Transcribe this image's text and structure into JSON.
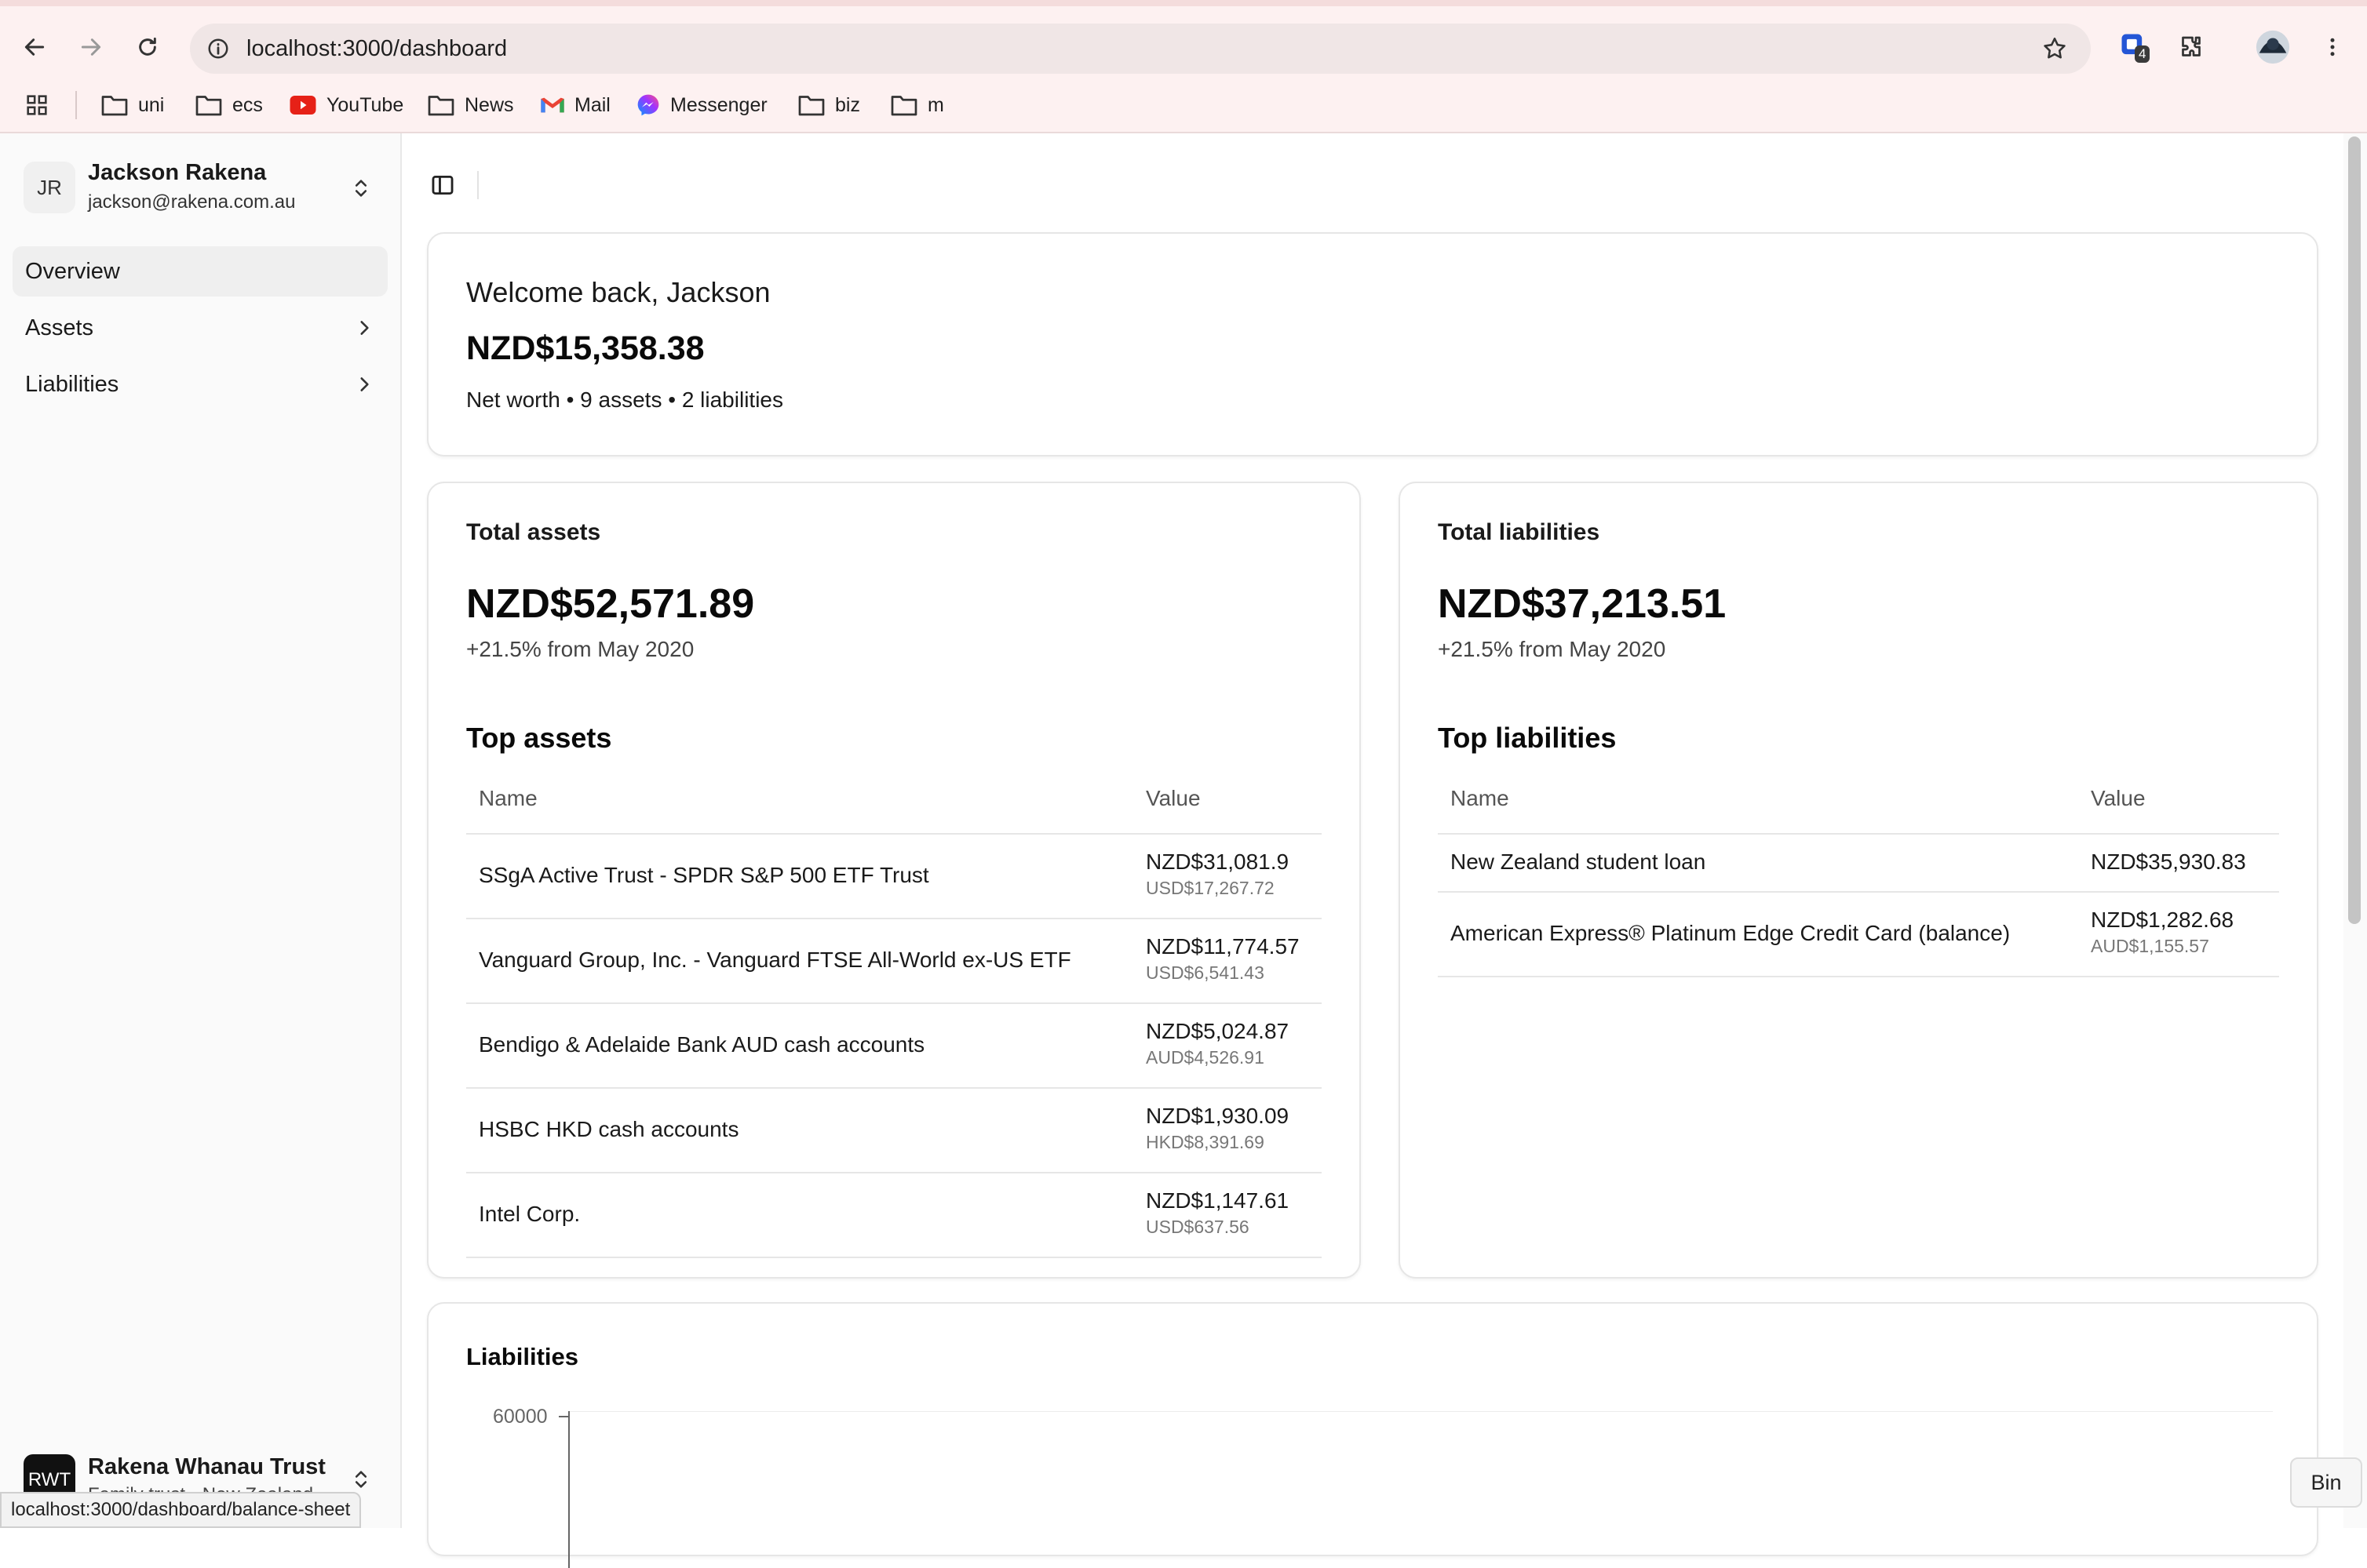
{
  "browser": {
    "url": "localhost:3000/dashboard",
    "extension_badge": "4",
    "bookmarks": [
      {
        "label": "uni",
        "icon": "folder-icon"
      },
      {
        "label": "ecs",
        "icon": "folder-icon"
      },
      {
        "label": "YouTube",
        "icon": "youtube-icon"
      },
      {
        "label": "News",
        "icon": "folder-icon"
      },
      {
        "label": "Mail",
        "icon": "gmail-icon"
      },
      {
        "label": "Messenger",
        "icon": "messenger-icon"
      },
      {
        "label": "biz",
        "icon": "folder-icon"
      },
      {
        "label": "m",
        "icon": "folder-icon"
      }
    ],
    "status_url": "localhost:3000/dashboard/balance-sheet"
  },
  "sidebar": {
    "user": {
      "initials": "JR",
      "name": "Jackson Rakena",
      "email": "jackson@rakena.com.au"
    },
    "items": [
      {
        "label": "Overview",
        "active": true
      },
      {
        "label": "Assets",
        "active": false
      },
      {
        "label": "Liabilities",
        "active": false
      }
    ],
    "org": {
      "initials": "RWT",
      "name": "Rakena Whanau Trust",
      "subtitle": "Family trust • New Zealand"
    }
  },
  "summary": {
    "welcome": "Welcome back, Jackson",
    "net_worth": "NZD$15,358.38",
    "subtitle": "Net worth • 9 assets • 2 liabilities"
  },
  "assets": {
    "title": "Total assets",
    "total": "NZD$52,571.89",
    "change": "+21.5% from May 2020",
    "top_title": "Top assets",
    "col_name": "Name",
    "col_value": "Value",
    "rows": [
      {
        "name": "SSgA Active Trust - SPDR S&P 500 ETF Trust",
        "value": "NZD$31,081.9",
        "sub": "USD$17,267.72"
      },
      {
        "name": "Vanguard Group, Inc. - Vanguard FTSE All-World ex-US ETF",
        "value": "NZD$11,774.57",
        "sub": "USD$6,541.43"
      },
      {
        "name": "Bendigo & Adelaide Bank AUD cash accounts",
        "value": "NZD$5,024.87",
        "sub": "AUD$4,526.91"
      },
      {
        "name": "HSBC HKD cash accounts",
        "value": "NZD$1,930.09",
        "sub": "HKD$8,391.69"
      },
      {
        "name": "Intel Corp.",
        "value": "NZD$1,147.61",
        "sub": "USD$637.56"
      }
    ]
  },
  "liabilities": {
    "title": "Total liabilities",
    "total": "NZD$37,213.51",
    "change": "+21.5% from May 2020",
    "top_title": "Top liabilities",
    "col_name": "Name",
    "col_value": "Value",
    "rows": [
      {
        "name": "New Zealand student loan",
        "value": "NZD$35,930.83",
        "sub": ""
      },
      {
        "name": "American Express® Platinum Edge Credit Card (balance)",
        "value": "NZD$1,282.68",
        "sub": "AUD$1,155.57"
      }
    ]
  },
  "liabilities_chart": {
    "label": "Liabilities",
    "y_tick_top": "60000"
  },
  "floating": {
    "bin_label": "Bin"
  }
}
